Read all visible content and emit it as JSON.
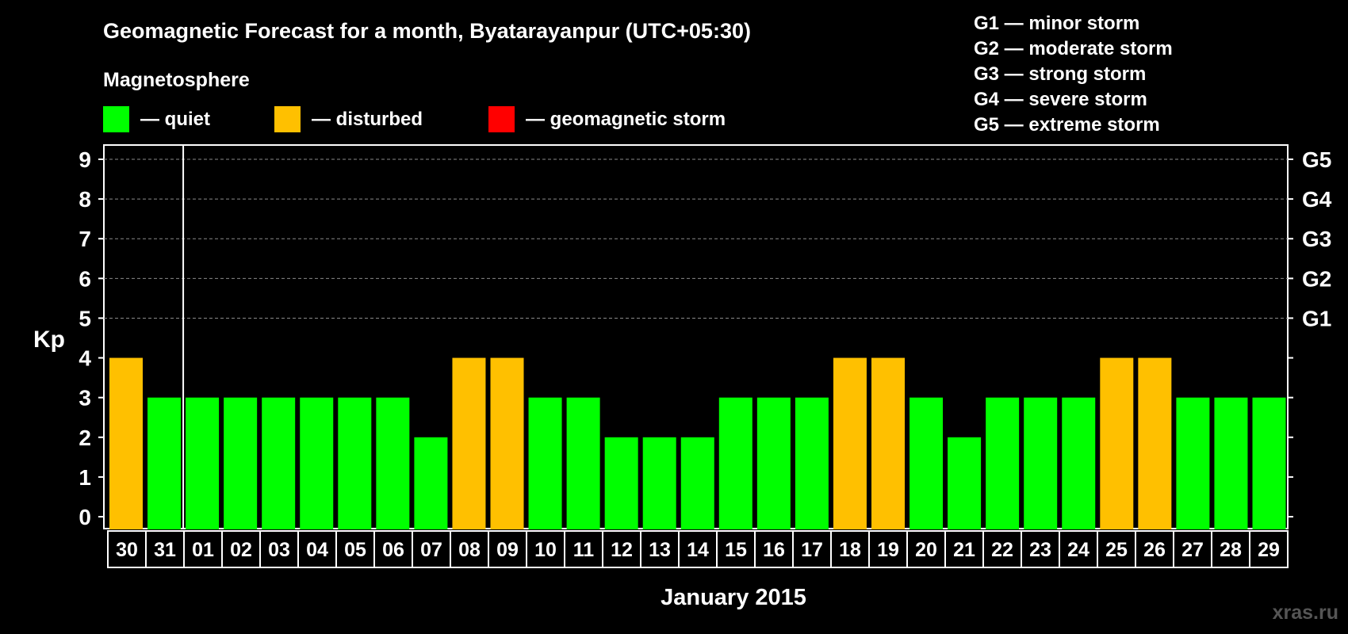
{
  "header": {
    "title": "Geomagnetic Forecast for a month, Byatarayanpur (UTC+05:30)",
    "section_label": "Magnetosphere",
    "watermark": "xras.ru"
  },
  "legend": {
    "quiet": {
      "label": "— quiet",
      "color": "#00ff00"
    },
    "disturbed": {
      "label": "— disturbed",
      "color": "#ffc000"
    },
    "storm": {
      "label": "— geomagnetic storm",
      "color": "#ff0000"
    }
  },
  "storm_scale": [
    "G1 — minor storm",
    "G2 — moderate storm",
    "G3 — strong storm",
    "G4 — severe storm",
    "G5 — extreme storm"
  ],
  "chart_data": {
    "type": "bar",
    "ylabel": "Kp",
    "xlabel": "January 2015",
    "ylim": [
      0,
      9
    ],
    "yticks": [
      0,
      1,
      2,
      3,
      4,
      5,
      6,
      7,
      8,
      9
    ],
    "right_axis": [
      {
        "kp": 5,
        "label": "G1"
      },
      {
        "kp": 6,
        "label": "G2"
      },
      {
        "kp": 7,
        "label": "G3"
      },
      {
        "kp": 8,
        "label": "G4"
      },
      {
        "kp": 9,
        "label": "G5"
      }
    ],
    "grid": "dashed above Kp 5",
    "categories": [
      "30",
      "31",
      "01",
      "02",
      "03",
      "04",
      "05",
      "06",
      "07",
      "08",
      "09",
      "10",
      "11",
      "12",
      "13",
      "14",
      "15",
      "16",
      "17",
      "18",
      "19",
      "20",
      "21",
      "22",
      "23",
      "24",
      "25",
      "26",
      "27",
      "28",
      "29"
    ],
    "values": [
      4,
      3,
      3,
      3,
      3,
      3,
      3,
      3,
      2,
      4,
      4,
      3,
      3,
      2,
      2,
      2,
      3,
      3,
      3,
      4,
      4,
      3,
      2,
      3,
      3,
      3,
      4,
      4,
      3,
      3,
      3
    ],
    "colors": {
      "quiet": "#00ff00",
      "disturbed": "#ffc000",
      "storm": "#ff0000"
    }
  }
}
